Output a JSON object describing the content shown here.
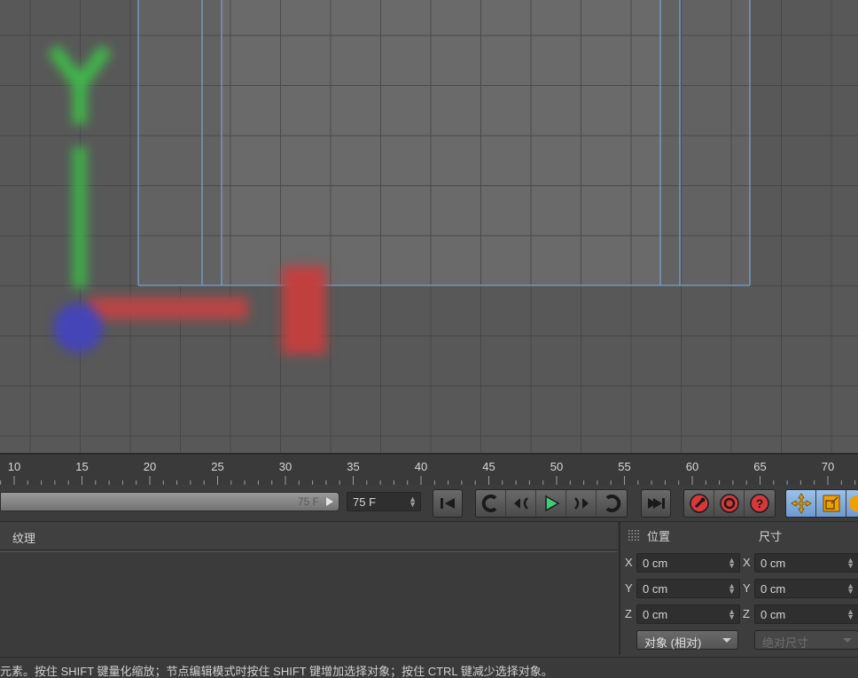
{
  "timeline": {
    "ticks": [
      "10",
      "15",
      "20",
      "25",
      "30",
      "35",
      "40",
      "45",
      "50",
      "55",
      "60",
      "65",
      "70"
    ]
  },
  "transport": {
    "range_end_label": "75 F",
    "current_frame": "75 F",
    "buttons": [
      "go-to-start-icon",
      "previous-key-icon",
      "previous-frame-icon",
      "play-icon",
      "next-frame-icon",
      "next-key-icon",
      "go-to-end-icon",
      "record-icon",
      "autokey-icon",
      "help-icon",
      "move-icon",
      "scale-icon"
    ],
    "colors": {
      "play": "#3ccf7a",
      "record": "#d9383a",
      "move": "#f0a000",
      "active_group_bg": "#7da7d8"
    }
  },
  "material_panel": {
    "title": "纹理"
  },
  "coordinates": {
    "position_header": "位置",
    "size_header": "尺寸",
    "axes": [
      "X",
      "Y",
      "Z"
    ],
    "position_values": [
      "0 cm",
      "0 cm",
      "0 cm"
    ],
    "size_values": [
      "0 cm",
      "0 cm",
      "0 cm"
    ],
    "mode_dropdown": "对象 (相对)",
    "size_dropdown": "绝对尺寸"
  },
  "status_bar": {
    "text": "元素。按住 SHIFT 键量化缩放；节点编辑模式时按住 SHIFT 键增加选择对象；按住 CTRL 键减少选择对象。"
  },
  "viewport_gizmo": {
    "y_axis_label": "Y"
  }
}
